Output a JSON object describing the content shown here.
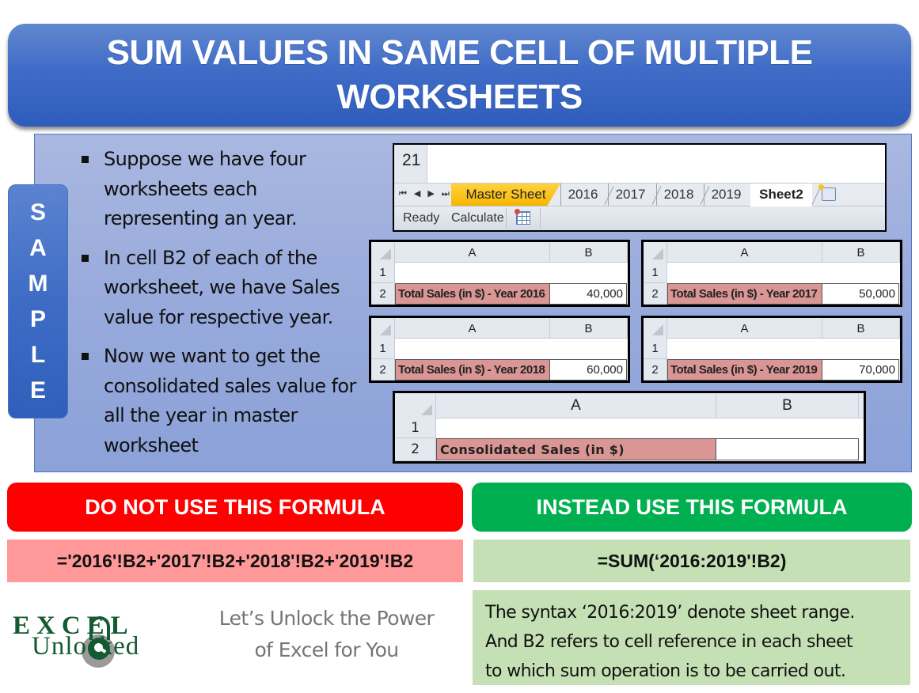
{
  "title": "SUM VALUES IN SAME CELL OF MULTIPLE WORKSHEETS",
  "sample_badge": [
    "S",
    "A",
    "M",
    "P",
    "L",
    "E"
  ],
  "bullets": [
    "Suppose we have four worksheets each representing an year.",
    "In cell B2 of each of the worksheet, we have Sales value for respective year.",
    "Now we want to get the consolidated sales value for all the year in master worksheet"
  ],
  "sheet_tabs_widget": {
    "row_number": "21",
    "nav_arrows": [
      "⏮",
      "◀",
      "▶",
      "⏭"
    ],
    "tabs": [
      {
        "label": "Master Sheet",
        "state": "highlighted",
        "color": "#f8b500"
      },
      {
        "label": "2016",
        "state": "normal"
      },
      {
        "label": "2017",
        "state": "normal"
      },
      {
        "label": "2018",
        "state": "normal"
      },
      {
        "label": "2019",
        "state": "normal"
      },
      {
        "label": "Sheet2",
        "state": "active"
      }
    ],
    "new_sheet_icon": "insert-worksheet-icon",
    "status": {
      "ready": "Ready",
      "calculate": "Calculate",
      "icon": "page-layout-icon"
    }
  },
  "mini_sheets": [
    {
      "col_a": "A",
      "col_b": "B",
      "row1": "1",
      "row2": "2",
      "label": "Total Sales (in $) - Year 2016",
      "value": "40,000"
    },
    {
      "col_a": "A",
      "col_b": "B",
      "row1": "1",
      "row2": "2",
      "label": "Total Sales (in $) - Year 2017",
      "value": "50,000"
    },
    {
      "col_a": "A",
      "col_b": "B",
      "row1": "1",
      "row2": "2",
      "label": "Total Sales (in $) - Year 2018",
      "value": "60,000"
    },
    {
      "col_a": "A",
      "col_b": "B",
      "row1": "1",
      "row2": "2",
      "label": "Total Sales (in $) - Year 2019",
      "value": "70,000"
    }
  ],
  "master_sheet": {
    "col_a": "A",
    "col_b": "B",
    "row1": "1",
    "row2": "2",
    "label": "Consolidated Sales (in $)",
    "value": ""
  },
  "bad_formula": {
    "header": "DO NOT USE THIS FORMULA",
    "formula": "='2016'!B2+'2017'!B2+'2018'!B2+'2019'!B2",
    "header_color": "#ff0000",
    "box_color": "#ff9999"
  },
  "good_formula": {
    "header": "INSTEAD USE THIS FORMULA",
    "formula": "=SUM(‘2016:2019'!B2)",
    "header_color": "#00b050",
    "box_color": "#c5e0b4",
    "explanation": [
      "The syntax ‘2016:2019’ denote sheet range.",
      "And B2 refers to cell reference in each sheet",
      "to which sum operation is to be carried out."
    ]
  },
  "logo": {
    "line1": "EXCEL",
    "line2": "Unlocked",
    "icon": "padlock-icon"
  },
  "tagline": [
    "Let’s Unlock the Power",
    "of Excel for You"
  ]
}
